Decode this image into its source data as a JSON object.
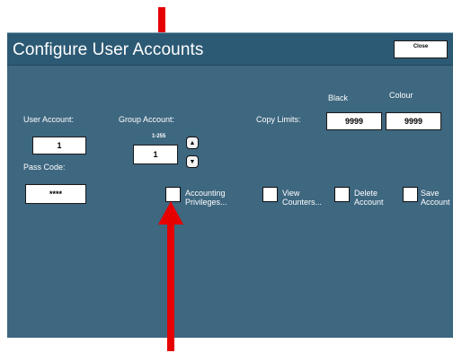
{
  "window": {
    "title": "Configure User Accounts",
    "close_label": "Close"
  },
  "user_account": {
    "label": "User Account:",
    "value": "1"
  },
  "pass_code": {
    "label": "Pass Code:",
    "value": "****"
  },
  "group_account": {
    "label": "Group Account:",
    "range": "1-255",
    "value": "1"
  },
  "copy_limits": {
    "label": "Copy Limits:",
    "black_label": "Black",
    "black_value": "9999",
    "colour_label": "Colour",
    "colour_value": "9999"
  },
  "options": [
    {
      "line1": "Accounting",
      "line2": "Privileges..."
    },
    {
      "line1": "View",
      "line2": "Counters..."
    },
    {
      "line1": "Delete",
      "line2": "Account"
    },
    {
      "line1": "Save",
      "line2": "Account"
    }
  ],
  "colors": {
    "panel": "#3e6780",
    "titlebar": "#2c5a74",
    "annotation_arrow": "#e60000"
  },
  "icons": {
    "spin_up": "chevron-up-icon",
    "spin_down": "chevron-down-icon",
    "annotation": "red-arrow-icon"
  }
}
